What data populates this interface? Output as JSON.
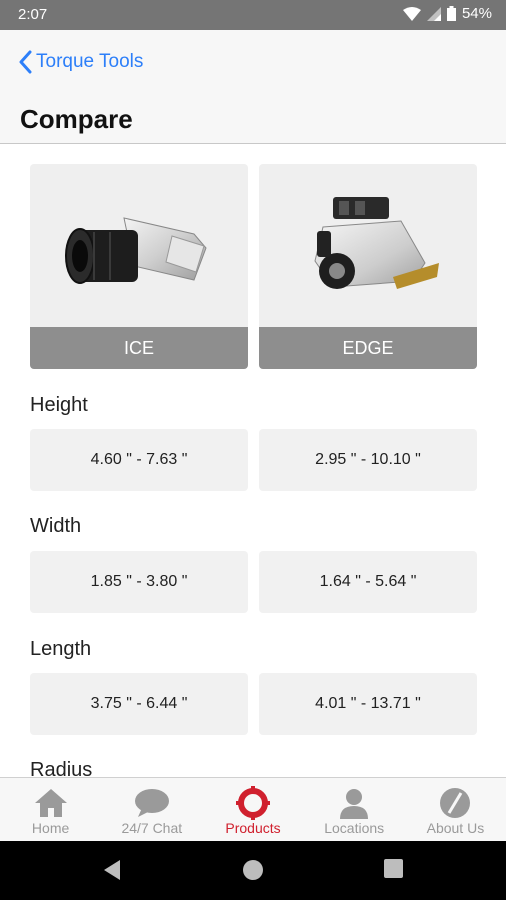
{
  "status_bar": {
    "time": "2:07",
    "battery": "54%"
  },
  "header": {
    "back_label": "Torque Tools",
    "title": "Compare"
  },
  "products": [
    {
      "name": "ICE"
    },
    {
      "name": "EDGE"
    }
  ],
  "specs": [
    {
      "label": "Height",
      "values": [
        "4.60 \" - 7.63 \"",
        "2.95 \" - 10.10 \""
      ]
    },
    {
      "label": "Width",
      "values": [
        "1.85 \" - 3.80 \"",
        "1.64 \" - 5.64 \""
      ]
    },
    {
      "label": "Length",
      "values": [
        "3.75 \" - 6.44 \"",
        "4.01 \" - 13.71 \""
      ]
    },
    {
      "label": "Radius",
      "values": [
        "",
        ""
      ]
    }
  ],
  "tabs": [
    {
      "label": "Home",
      "icon": "home-icon",
      "active": false
    },
    {
      "label": "24/7 Chat",
      "icon": "chat-icon",
      "active": false
    },
    {
      "label": "Products",
      "icon": "products-icon",
      "active": true
    },
    {
      "label": "Locations",
      "icon": "person-icon",
      "active": false
    },
    {
      "label": "About Us",
      "icon": "about-icon",
      "active": false
    }
  ],
  "colors": {
    "accent": "#2d7ff9",
    "active_tab": "#d0202e",
    "status_bar": "#757575"
  }
}
